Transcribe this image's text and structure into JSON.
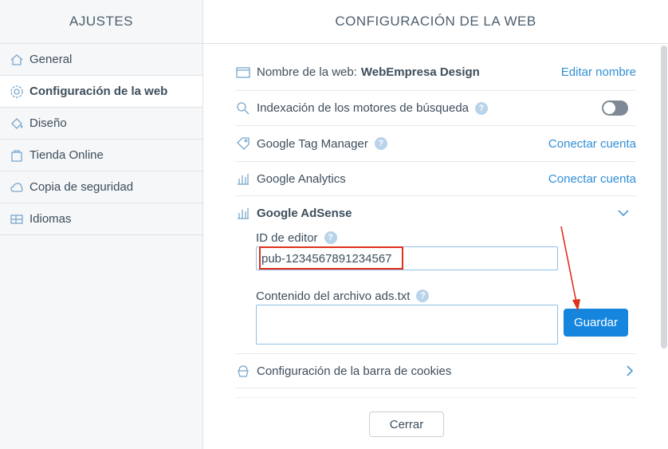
{
  "sidebar": {
    "title": "AJUSTES",
    "items": [
      {
        "label": "General",
        "icon": "home-icon"
      },
      {
        "label": "Configuración de la web",
        "icon": "gear-icon",
        "active": true
      },
      {
        "label": "Diseño",
        "icon": "paint-bucket-icon"
      },
      {
        "label": "Tienda Online",
        "icon": "shopping-bag-icon"
      },
      {
        "label": "Copia de seguridad",
        "icon": "cloud-icon"
      },
      {
        "label": "Idiomas",
        "icon": "languages-icon"
      }
    ]
  },
  "main": {
    "title": "CONFIGURACIÓN DE LA WEB",
    "site_name": {
      "label": "Nombre de la web:",
      "value": "WebEmpresa Design",
      "action": "Editar nombre"
    },
    "indexing": {
      "label": "Indexación de los motores de búsqueda",
      "help": "?",
      "enabled": false
    },
    "tag_manager": {
      "label": "Google Tag Manager",
      "help": "?",
      "action": "Conectar cuenta"
    },
    "analytics": {
      "label": "Google Analytics",
      "action": "Conectar cuenta"
    },
    "adsense": {
      "label": "Google AdSense",
      "publisher_label": "ID de editor",
      "publisher_help": "?",
      "publisher_value": "pub-1234567891234567",
      "ads_txt_label": "Contenido del archivo ads.txt",
      "ads_txt_help": "?",
      "ads_txt_value": "",
      "save_button": "Guardar"
    },
    "cookies": {
      "label": "Configuración de la barra de cookies"
    },
    "close_button": "Cerrar"
  },
  "colors": {
    "accent": "#1585de",
    "link": "#2f8fd6",
    "annotation": "#e0301e"
  }
}
